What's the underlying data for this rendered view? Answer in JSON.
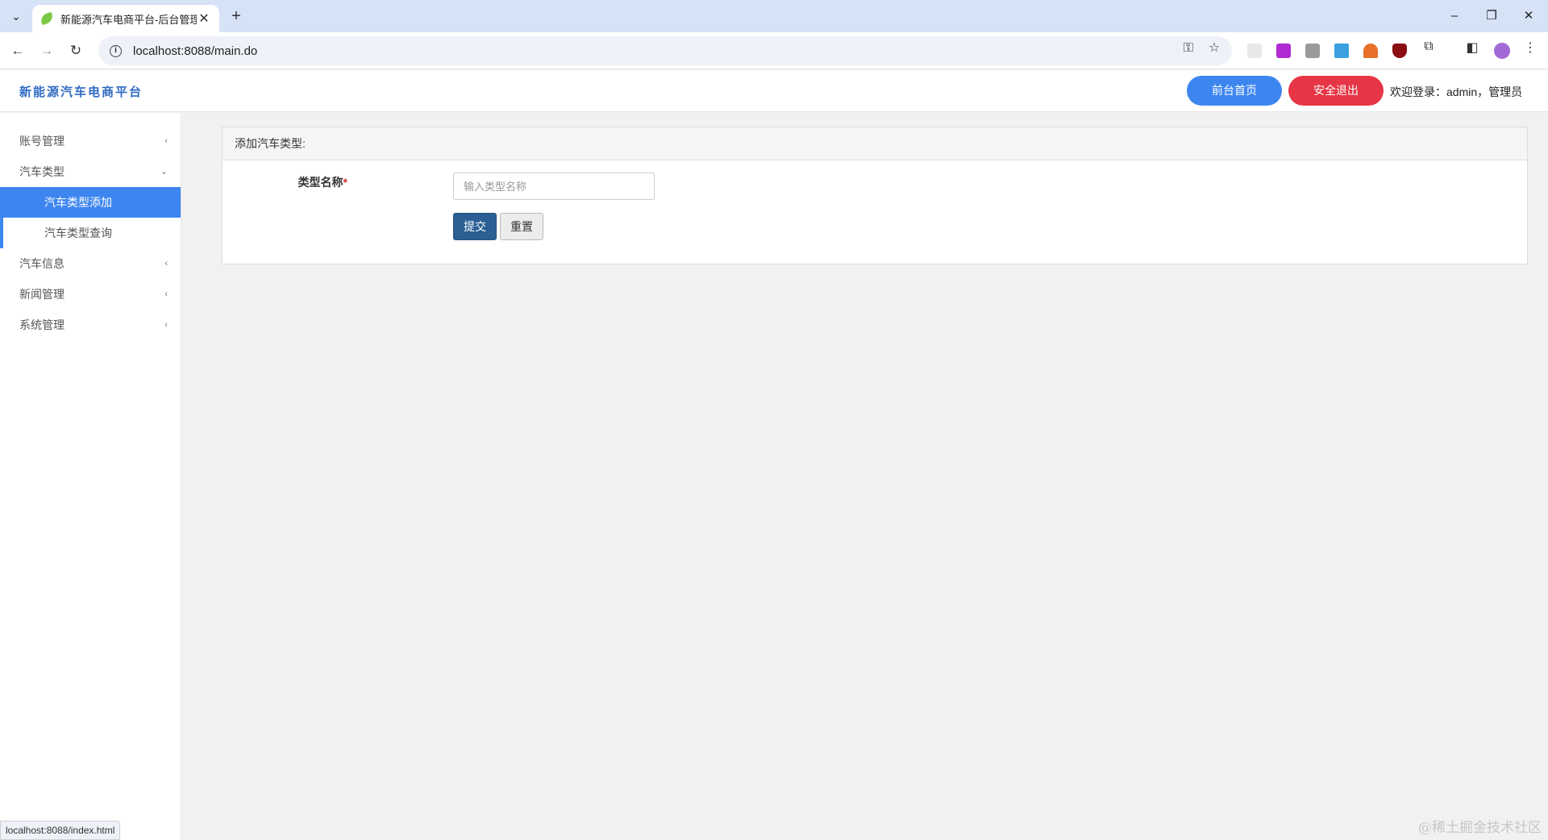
{
  "browser": {
    "tab_title": "新能源汽车电商平台-后台管理",
    "url": "localhost:8088/main.do",
    "status_url": "localhost:8088/index.html"
  },
  "header": {
    "brand": "新能源汽车电商平台",
    "front_home_label": "前台首页",
    "logout_label": "安全退出",
    "welcome": "欢迎登录：admin，管理员"
  },
  "sidebar": {
    "items": [
      {
        "label": "账号管理",
        "chevron": "‹"
      },
      {
        "label": "汽车类型",
        "chevron": "⌄"
      },
      {
        "label": "汽车信息",
        "chevron": "‹"
      },
      {
        "label": "新闻管理",
        "chevron": "‹"
      },
      {
        "label": "系统管理",
        "chevron": "‹"
      }
    ],
    "sub_items": [
      {
        "label": "汽车类型添加"
      },
      {
        "label": "汽车类型查询"
      }
    ]
  },
  "panel": {
    "title": "添加汽车类型:",
    "field_label": "类型名称",
    "required_mark": "*",
    "field_placeholder": "输入类型名称",
    "submit_label": "提交",
    "reset_label": "重置"
  },
  "watermark": "@稀土掘金技术社区",
  "colors": {
    "accent": "#3d86f0",
    "danger": "#e63545",
    "submit": "#2b5f94",
    "brand_text": "#2f6bc2"
  }
}
